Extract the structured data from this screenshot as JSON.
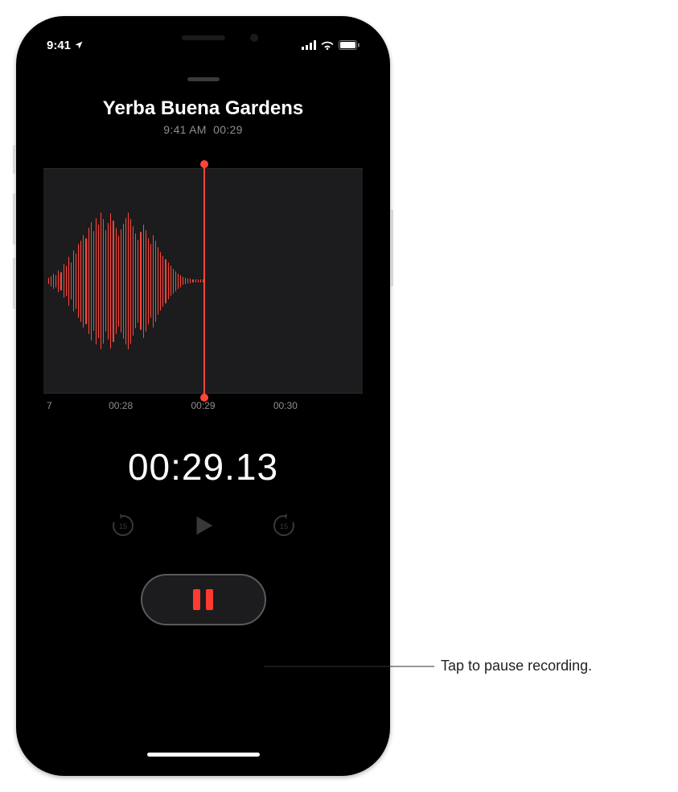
{
  "status": {
    "time": "9:41",
    "location_icon": "location-arrow"
  },
  "recording": {
    "title": "Yerba Buena Gardens",
    "time_label": "9:41 AM",
    "duration_short": "00:29",
    "elapsed": "00:29.13"
  },
  "timeline": {
    "t0": "7",
    "t1": "00:28",
    "t2": "00:29",
    "t3": "00:30",
    "t4": ""
  },
  "waveform": {
    "amplitudes": [
      8,
      12,
      18,
      14,
      26,
      22,
      40,
      36,
      58,
      44,
      72,
      66,
      88,
      96,
      110,
      102,
      126,
      140,
      118,
      150,
      134,
      162,
      148,
      120,
      138,
      160,
      144,
      126,
      108,
      122,
      136,
      150,
      162,
      148,
      130,
      112,
      98,
      116,
      134,
      120,
      102,
      88,
      110,
      96,
      80,
      70,
      60,
      52,
      44,
      36,
      30,
      24,
      18,
      14,
      10,
      8,
      6,
      6,
      4,
      4,
      4,
      4,
      4
    ]
  },
  "callout": {
    "text": "Tap to pause recording."
  }
}
